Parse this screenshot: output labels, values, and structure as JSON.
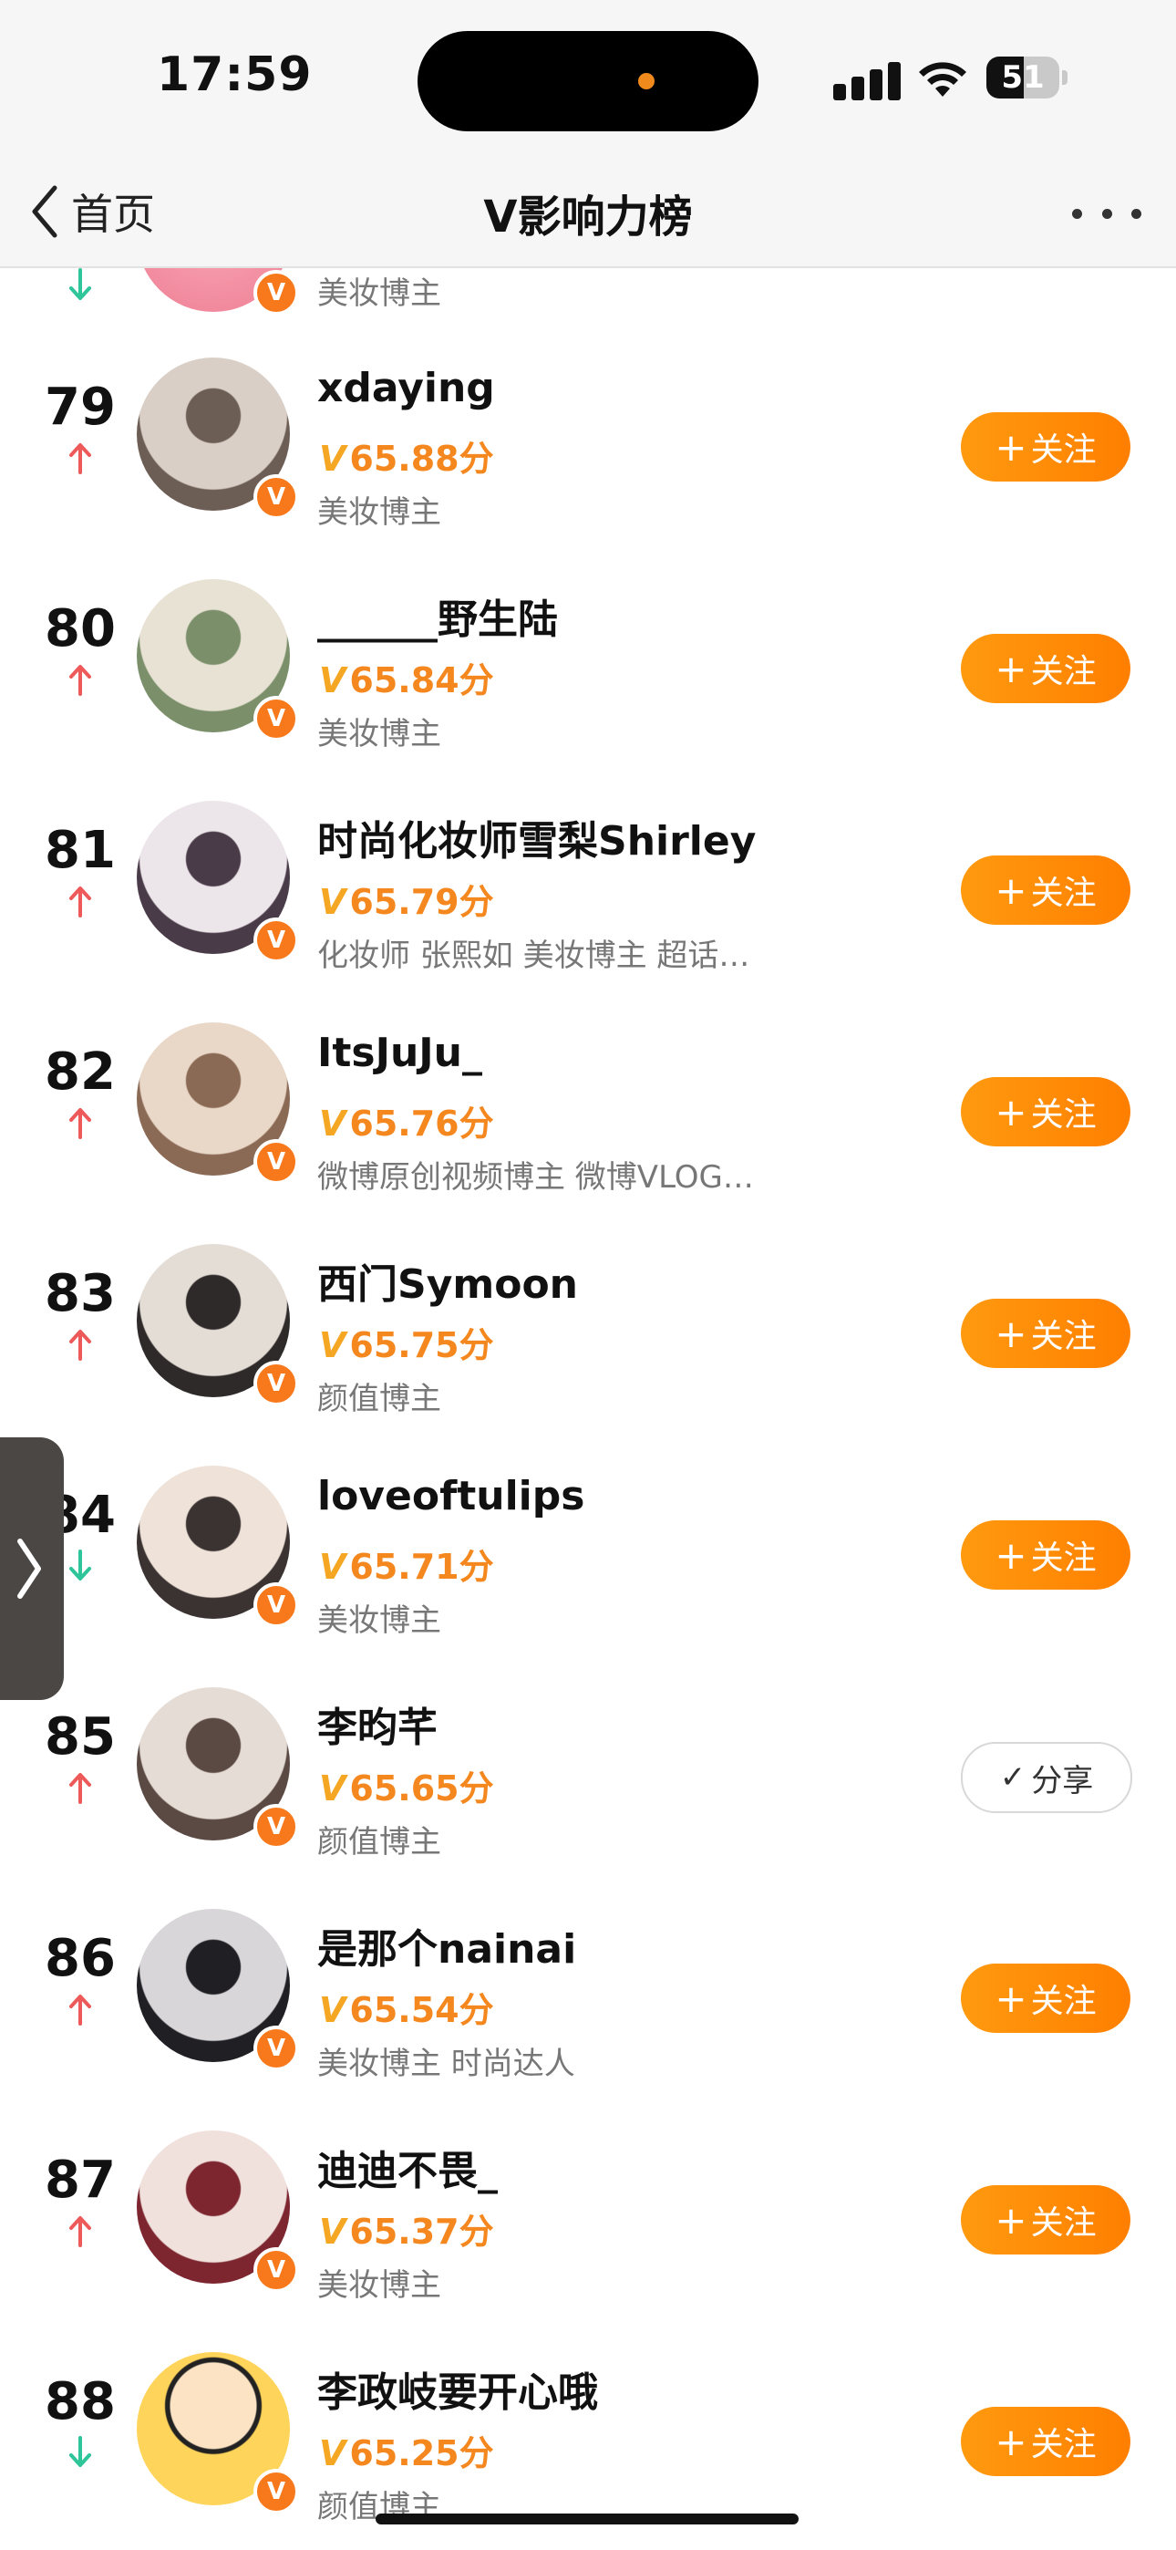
{
  "status_bar": {
    "time": "17:59",
    "battery": "51",
    "battery_level": 0.51
  },
  "nav": {
    "back_label": "首页",
    "title": "V影响力榜"
  },
  "colors": {
    "accent": "#f5871f",
    "follow_button": "#ff8a00",
    "verified_badge": "#f7791b",
    "trend_up": "#ee5a5a",
    "trend_down": "#2fc59a"
  },
  "partial_row": {
    "tags": "美妆博主",
    "trend": "down"
  },
  "rows": [
    {
      "rank": "79",
      "trend": "up",
      "name": "xdaying",
      "score_prefix": "V",
      "score": "65.88分",
      "tags": "美妆博主",
      "action": "follow",
      "action_label": "关注",
      "avatar": "avatar-photo"
    },
    {
      "rank": "80",
      "trend": "up",
      "name": "______野生陆",
      "score_prefix": "V",
      "score": "65.84分",
      "tags": "美妆博主",
      "action": "follow",
      "action_label": "关注",
      "avatar": "avatar-photo"
    },
    {
      "rank": "81",
      "trend": "up",
      "name": "时尚化妆师雪梨Shirley",
      "score_prefix": "V",
      "score": "65.79分",
      "tags": "化妆师 张熙如 美妆博主 超话…",
      "action": "follow",
      "action_label": "关注",
      "avatar": "avatar-photo"
    },
    {
      "rank": "82",
      "trend": "up",
      "name": "ItsJuJu_",
      "score_prefix": "V",
      "score": "65.76分",
      "tags": "微博原创视频博主 微博VLOG…",
      "action": "follow",
      "action_label": "关注",
      "avatar": "avatar-photo"
    },
    {
      "rank": "83",
      "trend": "up",
      "name": "西门Symoon",
      "score_prefix": "V",
      "score": "65.75分",
      "tags": "颜值博主",
      "action": "follow",
      "action_label": "关注",
      "avatar": "avatar-photo"
    },
    {
      "rank": "84",
      "trend": "down",
      "name": "loveoftulips",
      "score_prefix": "V",
      "score": "65.71分",
      "tags": "美妆博主",
      "action": "follow",
      "action_label": "关注",
      "avatar": "avatar-photo"
    },
    {
      "rank": "85",
      "trend": "up",
      "name": "李昀芊",
      "score_prefix": "V",
      "score": "65.65分",
      "tags": "颜值博主",
      "action": "share",
      "action_label": "分享",
      "avatar": "avatar-photo"
    },
    {
      "rank": "86",
      "trend": "up",
      "name": "是那个nainai",
      "score_prefix": "V",
      "score": "65.54分",
      "tags": "美妆博主 时尚达人",
      "action": "follow",
      "action_label": "关注",
      "avatar": "avatar-photo"
    },
    {
      "rank": "87",
      "trend": "up",
      "name": "迪迪不畏_",
      "score_prefix": "V",
      "score": "65.37分",
      "tags": "美妆博主",
      "action": "follow",
      "action_label": "关注",
      "avatar": "avatar-photo"
    },
    {
      "rank": "88",
      "trend": "down",
      "name": "李政岐要开心哦",
      "score_prefix": "V",
      "score": "65.25分",
      "tags": "颜值博主",
      "action": "follow",
      "action_label": "关注",
      "avatar": "avatar-cartoon"
    }
  ]
}
